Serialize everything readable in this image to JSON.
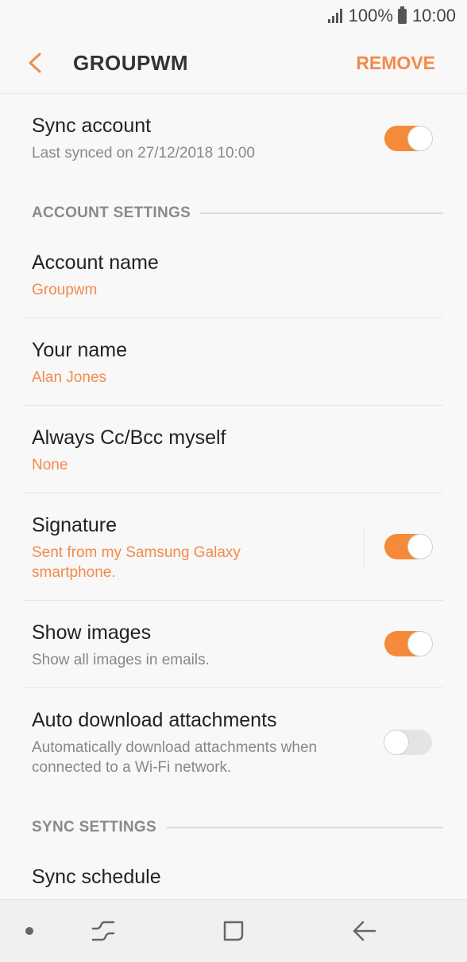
{
  "status_bar": {
    "battery": "100%",
    "time": "10:00"
  },
  "header": {
    "title": "GROUPWM",
    "remove_label": "REMOVE"
  },
  "sync_account": {
    "label": "Sync account",
    "sub": "Last synced on 27/12/2018  10:00",
    "enabled": true
  },
  "sections": {
    "account_settings": "ACCOUNT SETTINGS",
    "sync_settings": "SYNC SETTINGS"
  },
  "account_name": {
    "label": "Account name",
    "value": "Groupwm"
  },
  "your_name": {
    "label": "Your name",
    "value": "Alan Jones"
  },
  "always_cc": {
    "label": "Always Cc/Bcc myself",
    "value": "None"
  },
  "signature": {
    "label": "Signature",
    "value_line1": "Sent from my Samsung Galaxy",
    "value_line2": "smartphone.",
    "enabled": true
  },
  "show_images": {
    "label": "Show images",
    "sub": "Show all images in emails.",
    "enabled": true
  },
  "auto_download": {
    "label": "Auto download attachments",
    "sub_line1": "Automatically download attachments when",
    "sub_line2": "connected to a Wi-Fi network.",
    "enabled": false
  },
  "sync_schedule": {
    "label": "Sync schedule"
  },
  "colors": {
    "accent": "#f48a4a",
    "toggle_on": "#f48a3a",
    "toggle_off": "#e4e4e4"
  },
  "nav_icons": [
    "dot-icon",
    "recent-apps-icon",
    "home-icon",
    "back-icon"
  ]
}
